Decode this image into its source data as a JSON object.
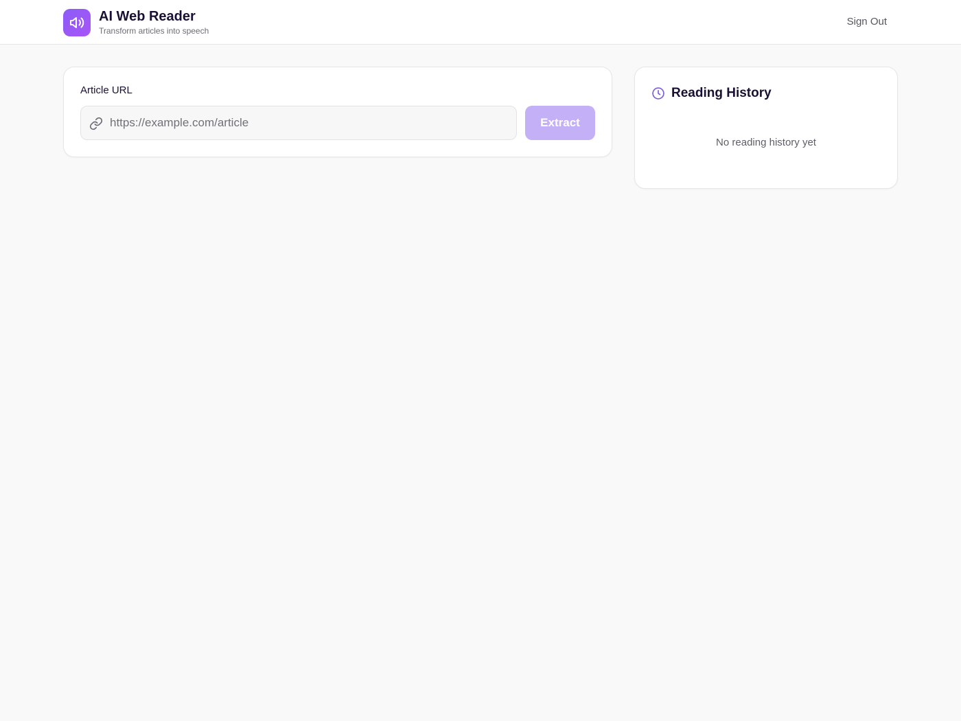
{
  "header": {
    "app_title": "AI Web Reader",
    "app_subtitle": "Transform articles into speech",
    "logo_icon": "speaker-icon",
    "sign_out_label": "Sign Out"
  },
  "article": {
    "label": "Article URL",
    "url_value": "",
    "url_placeholder": "https://example.com/article",
    "link_icon": "link-icon",
    "extract_label": "Extract"
  },
  "history": {
    "title": "Reading History",
    "icon": "clock-icon",
    "empty_text": "No reading history yet"
  },
  "colors": {
    "accent": "#8b5cf6",
    "accent_disabled": "#c4b0f7",
    "background": "#f9f9f9",
    "text": "#1a1033"
  }
}
